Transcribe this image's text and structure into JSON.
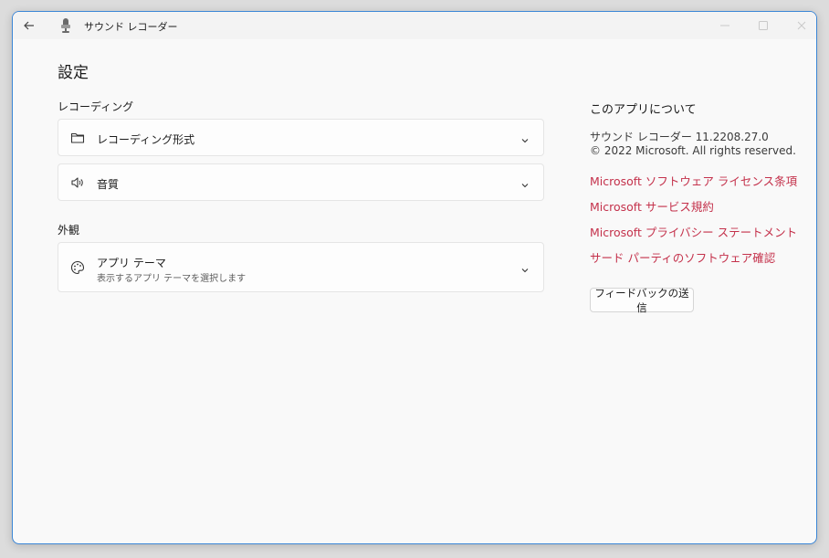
{
  "window": {
    "title": "サウンド レコーダー",
    "accent_color": "#3b86d6"
  },
  "icons": {
    "back": "back-arrow-icon",
    "app": "microphone-icon",
    "minimize": "minimize-icon",
    "maximize": "maximize-icon",
    "close": "close-icon",
    "folder": "folder-icon",
    "speaker": "speaker-icon",
    "palette": "palette-icon",
    "chevron": "chevron-down-icon"
  },
  "page": {
    "title": "設定"
  },
  "recording": {
    "label": "レコーディング",
    "format": {
      "label": "レコーディング形式"
    },
    "quality": {
      "label": "音質"
    }
  },
  "appearance": {
    "label": "外観",
    "theme": {
      "label": "アプリ テーマ",
      "description": "表示するアプリ テーマを選択します"
    }
  },
  "about": {
    "title": "このアプリについて",
    "version": "サウンド レコーダー 11.2208.27.0",
    "copyright": "© 2022 Microsoft. All rights reserved.",
    "link_color": "#c4314b",
    "links": [
      "Microsoft ソフトウェア ライセンス条項",
      "Microsoft サービス規約",
      "Microsoft プライバシー ステートメント",
      "サード パーティのソフトウェア確認"
    ],
    "feedback_button": "フィードバックの送信"
  }
}
